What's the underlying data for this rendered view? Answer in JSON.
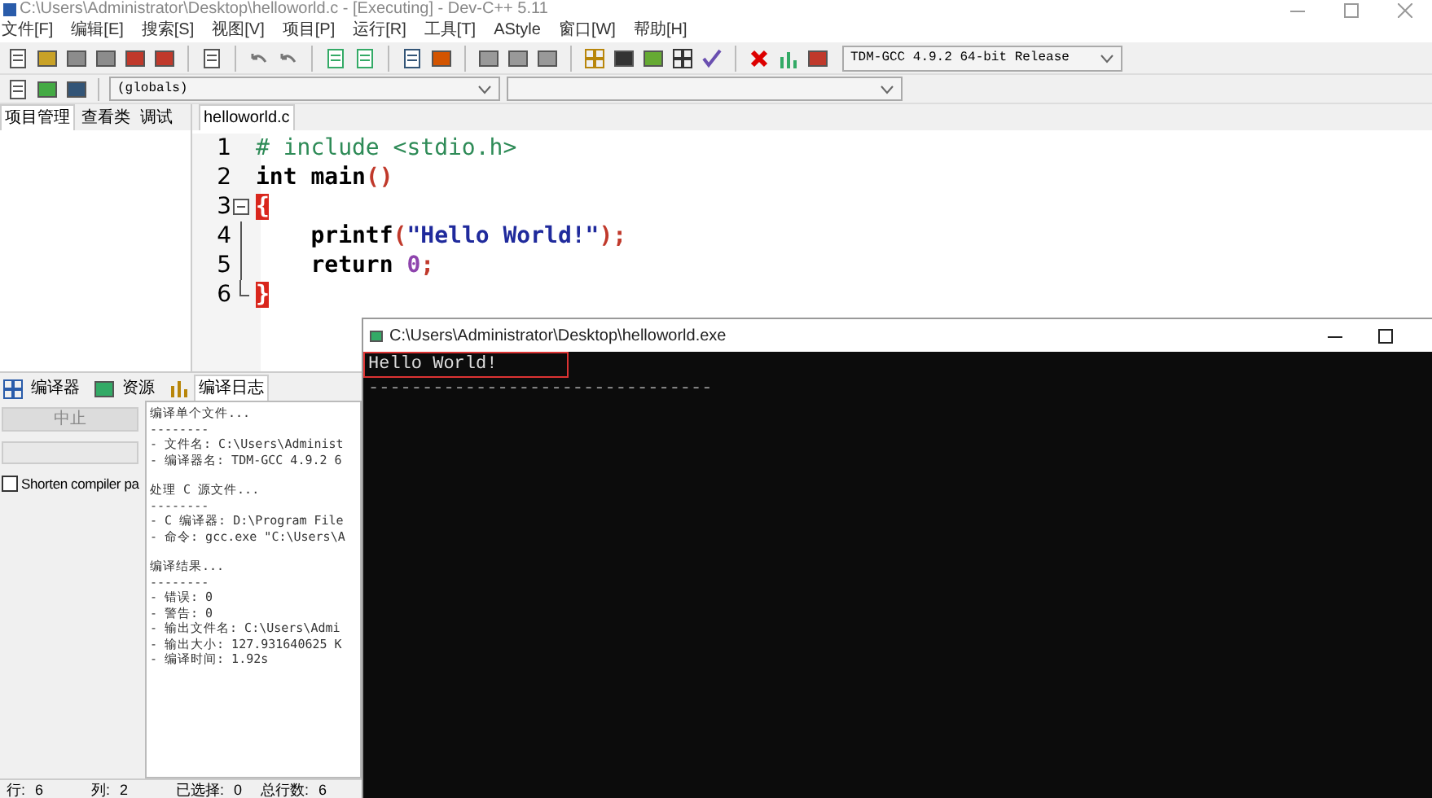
{
  "window": {
    "title": "C:\\Users\\Administrator\\Desktop\\helloworld.c - [Executing] - Dev-C++ 5.11"
  },
  "menu": [
    "文件[F]",
    "编辑[E]",
    "搜索[S]",
    "视图[V]",
    "项目[P]",
    "运行[R]",
    "工具[T]",
    "AStyle",
    "窗口[W]",
    "帮助[H]"
  ],
  "compiler_select": {
    "value": "TDM-GCC 4.9.2 64-bit Release"
  },
  "scope_select": {
    "value": "(globals)"
  },
  "left_tabs": [
    {
      "label": "项目管理",
      "selected": true
    },
    {
      "label": "查看类",
      "selected": false
    },
    {
      "label": "调试",
      "selected": false
    }
  ],
  "editor_tabs": [
    {
      "label": "helloworld.c",
      "selected": true
    }
  ],
  "code": [
    {
      "number": "1",
      "kind": "plain",
      "tokens": [
        {
          "kind": "preprocessor",
          "text": "# include <stdio.h>"
        }
      ]
    },
    {
      "number": "2",
      "kind": "plain",
      "tokens": [
        {
          "kind": "keyword",
          "text": "int main"
        },
        {
          "kind": "symbol",
          "text": "()"
        }
      ]
    },
    {
      "number": "3",
      "kind": "fold_start",
      "tokens": [
        {
          "kind": "brace_match",
          "text": "{"
        }
      ]
    },
    {
      "number": "4",
      "kind": "fold_body",
      "tokens": [
        {
          "kind": "plain",
          "text": "    printf"
        },
        {
          "kind": "symbol",
          "text": "("
        },
        {
          "kind": "string",
          "text": "\"Hello World!\""
        },
        {
          "kind": "symbol",
          "text": ");"
        }
      ]
    },
    {
      "number": "5",
      "kind": "fold_body",
      "tokens": [
        {
          "kind": "keyword",
          "text": "    return "
        },
        {
          "kind": "number",
          "text": "0"
        },
        {
          "kind": "symbol",
          "text": ";"
        }
      ]
    },
    {
      "number": "6",
      "kind": "fold_end",
      "tokens": [
        {
          "kind": "brace_match",
          "text": "}"
        }
      ]
    }
  ],
  "bottom_tabs": [
    {
      "label": "编译器",
      "selected": false
    },
    {
      "label": "资源",
      "selected": false
    },
    {
      "label": "编译日志",
      "selected": true
    }
  ],
  "abort_button": {
    "label": "中止",
    "disabled": true
  },
  "shorten_paths": {
    "label": "Shorten compiler pa",
    "checked": false
  },
  "compile_log": [
    "编译单个文件...",
    "--------",
    "- 文件名: C:\\Users\\Administ",
    "- 编译器名: TDM-GCC 4.9.2 6",
    "处理 C 源文件...",
    "--------",
    "- C 编译器: D:\\Program File",
    "- 命令: gcc.exe \"C:\\Users\\A",
    "编译结果...",
    "--------",
    "- 错误: 0",
    "- 警告: 0",
    "- 输出文件名: C:\\Users\\Admi",
    "- 输出大小: 127.931640625 K",
    "- 编译时间: 1.92s"
  ],
  "status_bar": [
    {
      "label": "行:",
      "value": "6"
    },
    {
      "label": "列:",
      "value": "2"
    },
    {
      "label": "已选择:",
      "value": "0"
    },
    {
      "label": "总行数:",
      "value": "6"
    }
  ],
  "console": {
    "title": "C:\\Users\\Administrator\\Desktop\\helloworld.exe",
    "lines": [
      {
        "kind": "output",
        "text": "Hello World!",
        "highlighted": true
      },
      {
        "kind": "rule",
        "text": "--------------------------------",
        "highlighted": false
      }
    ]
  }
}
